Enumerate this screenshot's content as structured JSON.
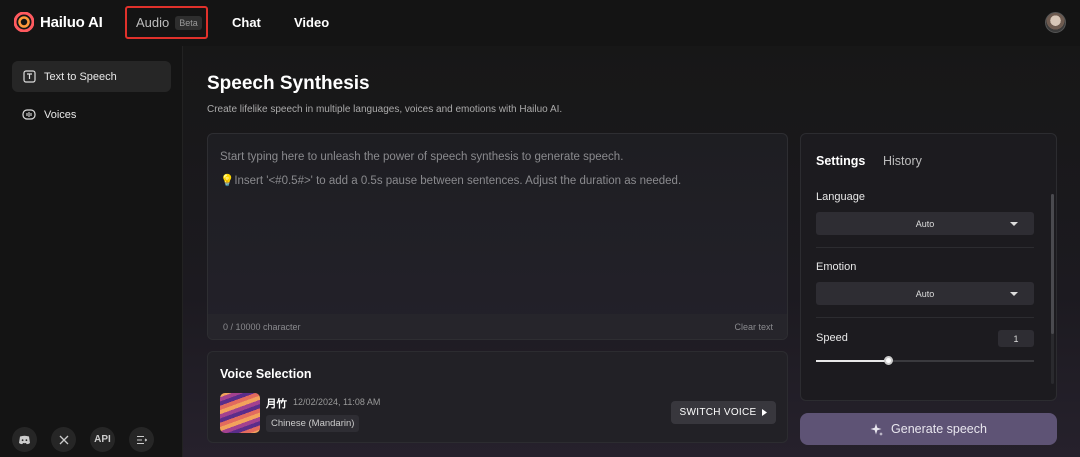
{
  "brand": {
    "name": "Hailuo AI"
  },
  "nav": {
    "audio": {
      "label": "Audio",
      "badge": "Beta"
    },
    "chat": "Chat",
    "video": "Video"
  },
  "sidebar": {
    "items": [
      {
        "label": "Text to Speech",
        "icon": "text-to-speech-icon",
        "active": true
      },
      {
        "label": "Voices",
        "icon": "voices-icon",
        "active": false
      }
    ],
    "bottom": {
      "api_label": "API"
    }
  },
  "page": {
    "title": "Speech Synthesis",
    "subtitle": "Create lifelike speech in multiple languages, voices and emotions with Hailuo AI."
  },
  "editor": {
    "placeholder_line1": "Start typing here to unleash the power of speech synthesis to generate speech.",
    "placeholder_line2": "💡Insert '<#0.5#>' to add a 0.5s pause between sentences. Adjust the duration as needed.",
    "char_count": "0 / 10000 character",
    "clear_label": "Clear text"
  },
  "voice_selection": {
    "title": "Voice Selection",
    "voice_name": "月竹",
    "voice_date": "12/02/2024, 11:08 AM",
    "voice_language": "Chinese (Mandarin)",
    "switch_label": "SWITCH VOICE"
  },
  "settings": {
    "tabs": [
      "Settings",
      "History"
    ],
    "language": {
      "label": "Language",
      "value": "Auto"
    },
    "emotion": {
      "label": "Emotion",
      "value": "Auto"
    },
    "speed": {
      "label": "Speed",
      "value": "1",
      "level_fraction": 0.33
    }
  },
  "generate": {
    "label": "Generate speech"
  },
  "colors": {
    "accent_button": "#5e5375",
    "highlight_border": "#e0312b"
  }
}
